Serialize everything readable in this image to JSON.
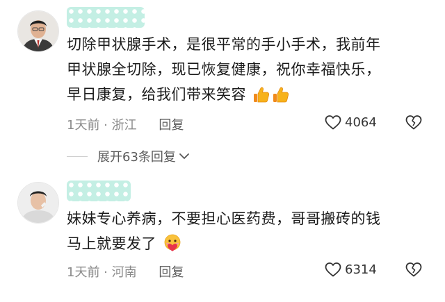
{
  "comments": [
    {
      "lines": [
        "切除甲状腺手术，是很平常的手小手术，我前年",
        "甲状腺全切除，现已恢复健康，祝你幸福快乐，",
        "早日康复，给我们带来笑容"
      ],
      "emoji": [
        "thumbs-up",
        "thumbs-up"
      ],
      "meta": "1天前 · 浙江",
      "reply_label": "回复",
      "likes": "4064"
    },
    {
      "lines": [
        "妹妹专心养病，不要担心医药费，哥哥搬砖的钱",
        "马上就要发了"
      ],
      "emoji": [
        "heart-face"
      ],
      "meta": "1天前 · 河南",
      "reply_label": "回复",
      "likes": "6314"
    }
  ],
  "expand_replies_label": "展开63条回复",
  "colors": {
    "username_mask": "#c4efe4",
    "meta_text": "#8a8a8a"
  }
}
